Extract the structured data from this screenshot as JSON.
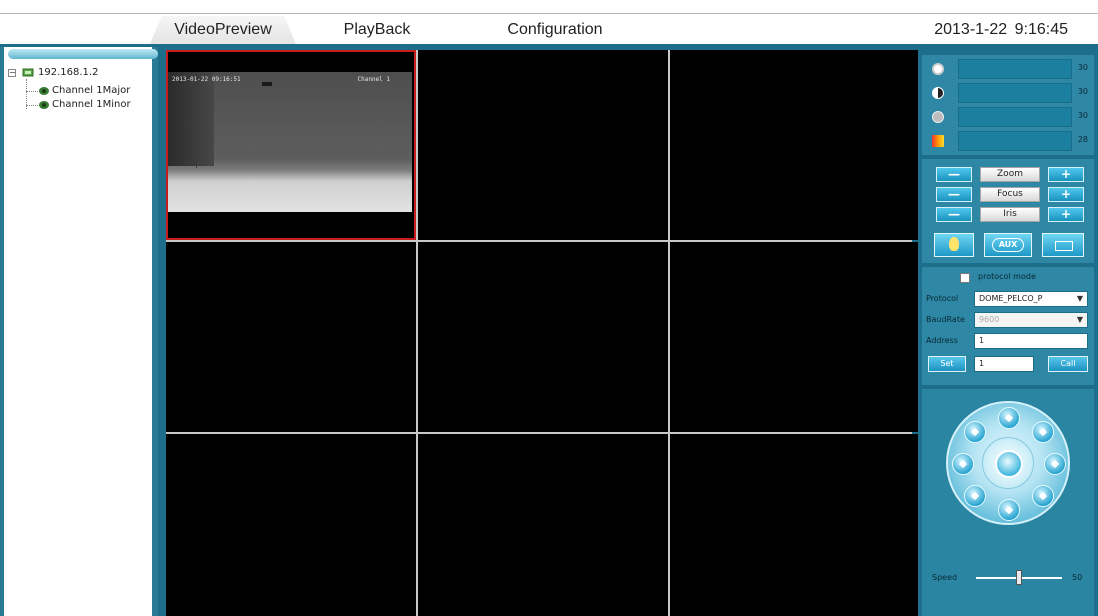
{
  "topbar": {
    "tabs": [
      {
        "label": "VideoPreview",
        "active": true
      },
      {
        "label": "PlayBack",
        "active": false
      },
      {
        "label": "Configuration",
        "active": false
      }
    ],
    "datetime": "2013-1-22  9:16:45"
  },
  "device_tree": {
    "device": "192.168.1.2",
    "channels": [
      "Channel 1Major",
      "Channel 1Minor"
    ]
  },
  "video_grid": {
    "layout": "3x3",
    "selected_cell": 1,
    "osd": {
      "timestamp": "2013-01-22 09:16:51",
      "channel": "Channel 1"
    }
  },
  "image_settings": {
    "brightness": "30",
    "contrast": "30",
    "saturation": "30",
    "hue": "28"
  },
  "lens": {
    "zoom_label": "Zoom",
    "focus_label": "Focus",
    "iris_label": "Iris",
    "minus": "—",
    "plus": "+",
    "aux_label": "AUX"
  },
  "protocol": {
    "mode_label": "protocol mode",
    "protocol_label": "Protocol",
    "protocol_value": "DOME_PELCO_P",
    "baudrate_label": "BaudRate",
    "baudrate_value": "9600",
    "address_label": "Address",
    "address_value": "1",
    "set_label": "Set",
    "preset_value": "1",
    "call_label": "Call"
  },
  "ptz": {
    "speed_label": "Speed",
    "speed_value": "50"
  },
  "colors": {
    "frame_blue": "#1d6e8a",
    "panel_blue": "#2d87a5",
    "selection_red": "#c81c1c"
  }
}
